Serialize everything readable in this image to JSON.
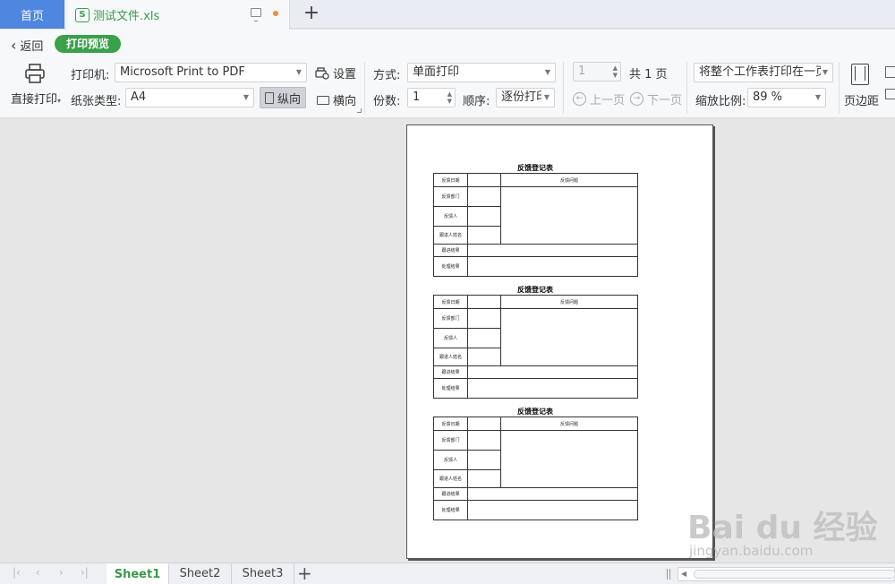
{
  "tabs": {
    "home": "首页",
    "file": "测试文件.xls",
    "file_icon": "S"
  },
  "toolbar": {
    "back": "返回",
    "mode": "打印预览",
    "direct_print": "直接打印",
    "printer_label": "打印机:",
    "printer_value": "Microsoft Print to PDF",
    "settings": "设置",
    "paper_label": "纸张类型:",
    "paper_value": "A4",
    "portrait": "纵向",
    "landscape": "横向",
    "method_label": "方式:",
    "method_value": "单面打印",
    "copies_label": "份数:",
    "copies_value": "1",
    "order_label": "顺序:",
    "order_value": "逐份打印",
    "page_value": "1",
    "total_pages": "共 1 页",
    "prev_page": "上一页",
    "next_page": "下一页",
    "fit_value": "将整个工作表打印在一页",
    "scale_label": "缩放比例:",
    "scale_value": "89 %",
    "margins": "页边距"
  },
  "preview": {
    "forms": [
      {
        "title": "反馈登记表",
        "rows": {
          "date": "反馈日期",
          "question": "反馈问题",
          "dept": "反馈部门",
          "person": "反馈人",
          "follower": "跟进人姓名",
          "progress": "跟进结果",
          "result": "处理结果"
        }
      },
      {
        "title": "反馈登记表",
        "rows": {
          "date": "反馈日期",
          "question": "反馈问题",
          "dept": "反馈部门",
          "person": "反馈人",
          "follower": "跟进人姓名",
          "progress": "跟进结果",
          "result": "处理结果"
        }
      },
      {
        "title": "反馈登记表",
        "rows": {
          "date": "反馈日期",
          "question": "反馈问题",
          "dept": "反馈部门",
          "person": "反馈人",
          "follower": "跟进人姓名",
          "progress": "跟进结果",
          "result": "处理结果"
        }
      }
    ]
  },
  "sheets": {
    "tabs": [
      "Sheet1",
      "Sheet2",
      "Sheet3"
    ],
    "active": "Sheet1"
  },
  "watermark": {
    "brand": "Bai du 经验",
    "url": "jingyan.baidu.com"
  },
  "colors": {
    "accent_green": "#3aa04a",
    "home_tab_blue": "#4e86e0"
  }
}
